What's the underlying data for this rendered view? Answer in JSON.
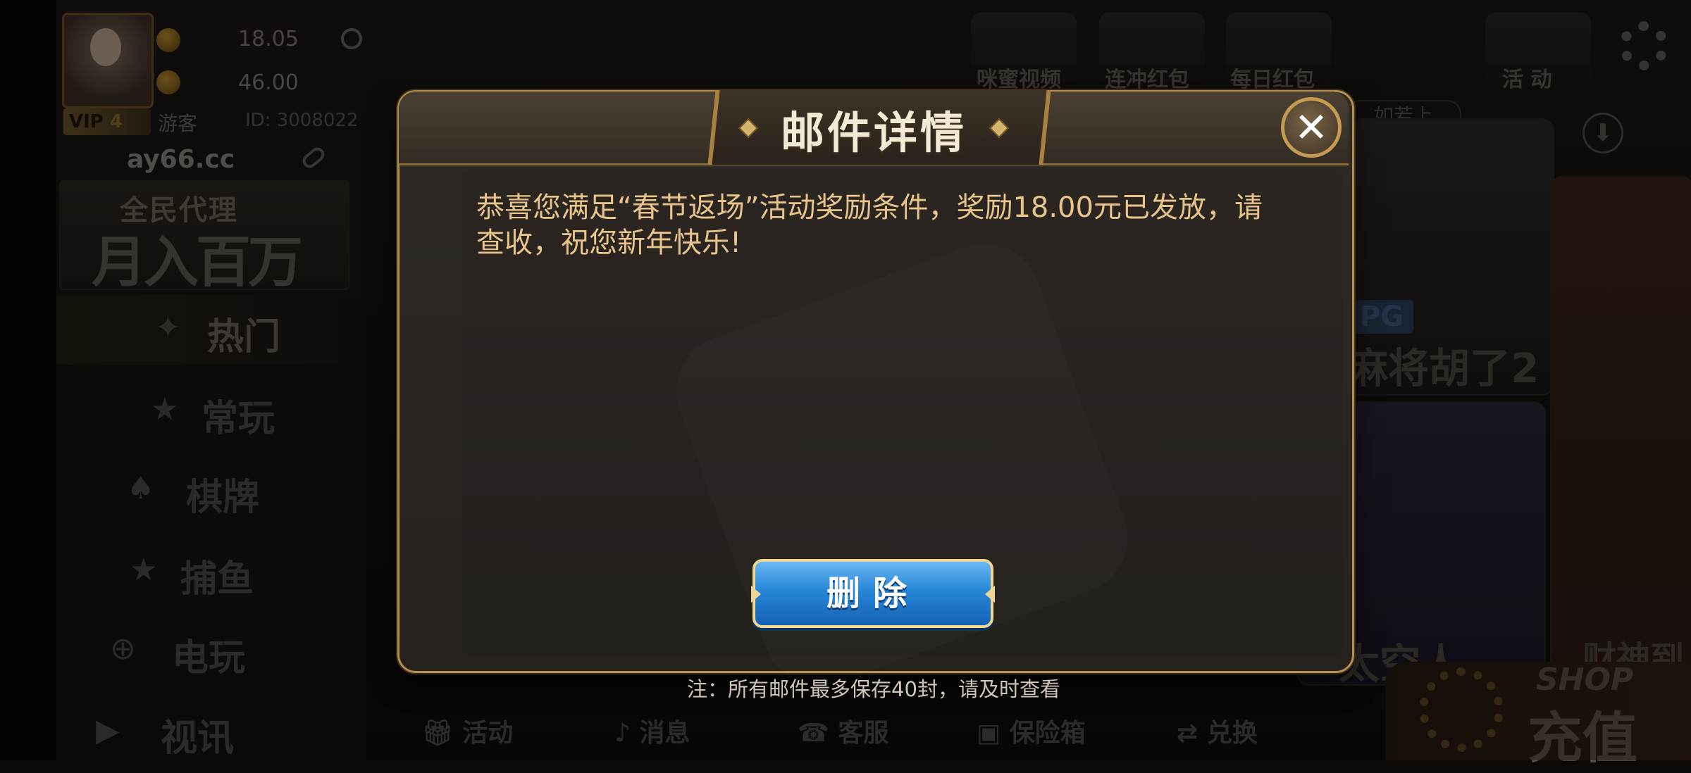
{
  "player": {
    "balance_gold": "18.05",
    "balance_secondary": "46.00",
    "vip_label": "VIP",
    "vip_level": "4",
    "user_type": "游客",
    "id_label": "ID: 3008022",
    "site": "ay66.cc"
  },
  "agent_banner": {
    "line1": "全民代理",
    "line2": "月入百万"
  },
  "sidebar": {
    "items": [
      {
        "label": "热门",
        "icon": "sparkle-icon"
      },
      {
        "label": "常玩",
        "icon": "star-icon"
      },
      {
        "label": "棋牌",
        "icon": "cards-icon"
      },
      {
        "label": "捕鱼",
        "icon": "star-icon"
      },
      {
        "label": "电玩",
        "icon": "gamepad-icon"
      },
      {
        "label": "视讯",
        "icon": "video-icon"
      }
    ]
  },
  "top_icons": [
    {
      "label": "咪蜜视频"
    },
    {
      "label": "连冲红包"
    },
    {
      "label": "每日红包"
    },
    {
      "label": "活   动"
    }
  ],
  "marquee_text": "如若上",
  "games": [
    {
      "badge": "PG",
      "label": "麻将胡了2"
    },
    {
      "label": "太空人"
    },
    {
      "label": "财神到"
    }
  ],
  "bottom_bar": [
    {
      "label": "活动",
      "icon": "gift-icon"
    },
    {
      "label": "消息",
      "icon": "bell-icon"
    },
    {
      "label": "客服",
      "icon": "phone-icon"
    },
    {
      "label": "保险箱",
      "icon": "safe-icon"
    },
    {
      "label": "兑换",
      "icon": "exchange-icon"
    }
  ],
  "shop": {
    "label": "SHOP",
    "recharge": "充值"
  },
  "dialog": {
    "title": "邮件详情",
    "body": "恭喜您满足“春节返场”活动奖励条件，奖励18.00元已发放，请查收，祝您新年快乐!",
    "delete_label": "删除",
    "note": "注：所有邮件最多保存40封，请及时查看"
  },
  "colors": {
    "dialog_border": "#b28f4c",
    "body_text": "#e8c48b",
    "delete_button": "#2787d8",
    "title_text": "#f3ead6"
  }
}
